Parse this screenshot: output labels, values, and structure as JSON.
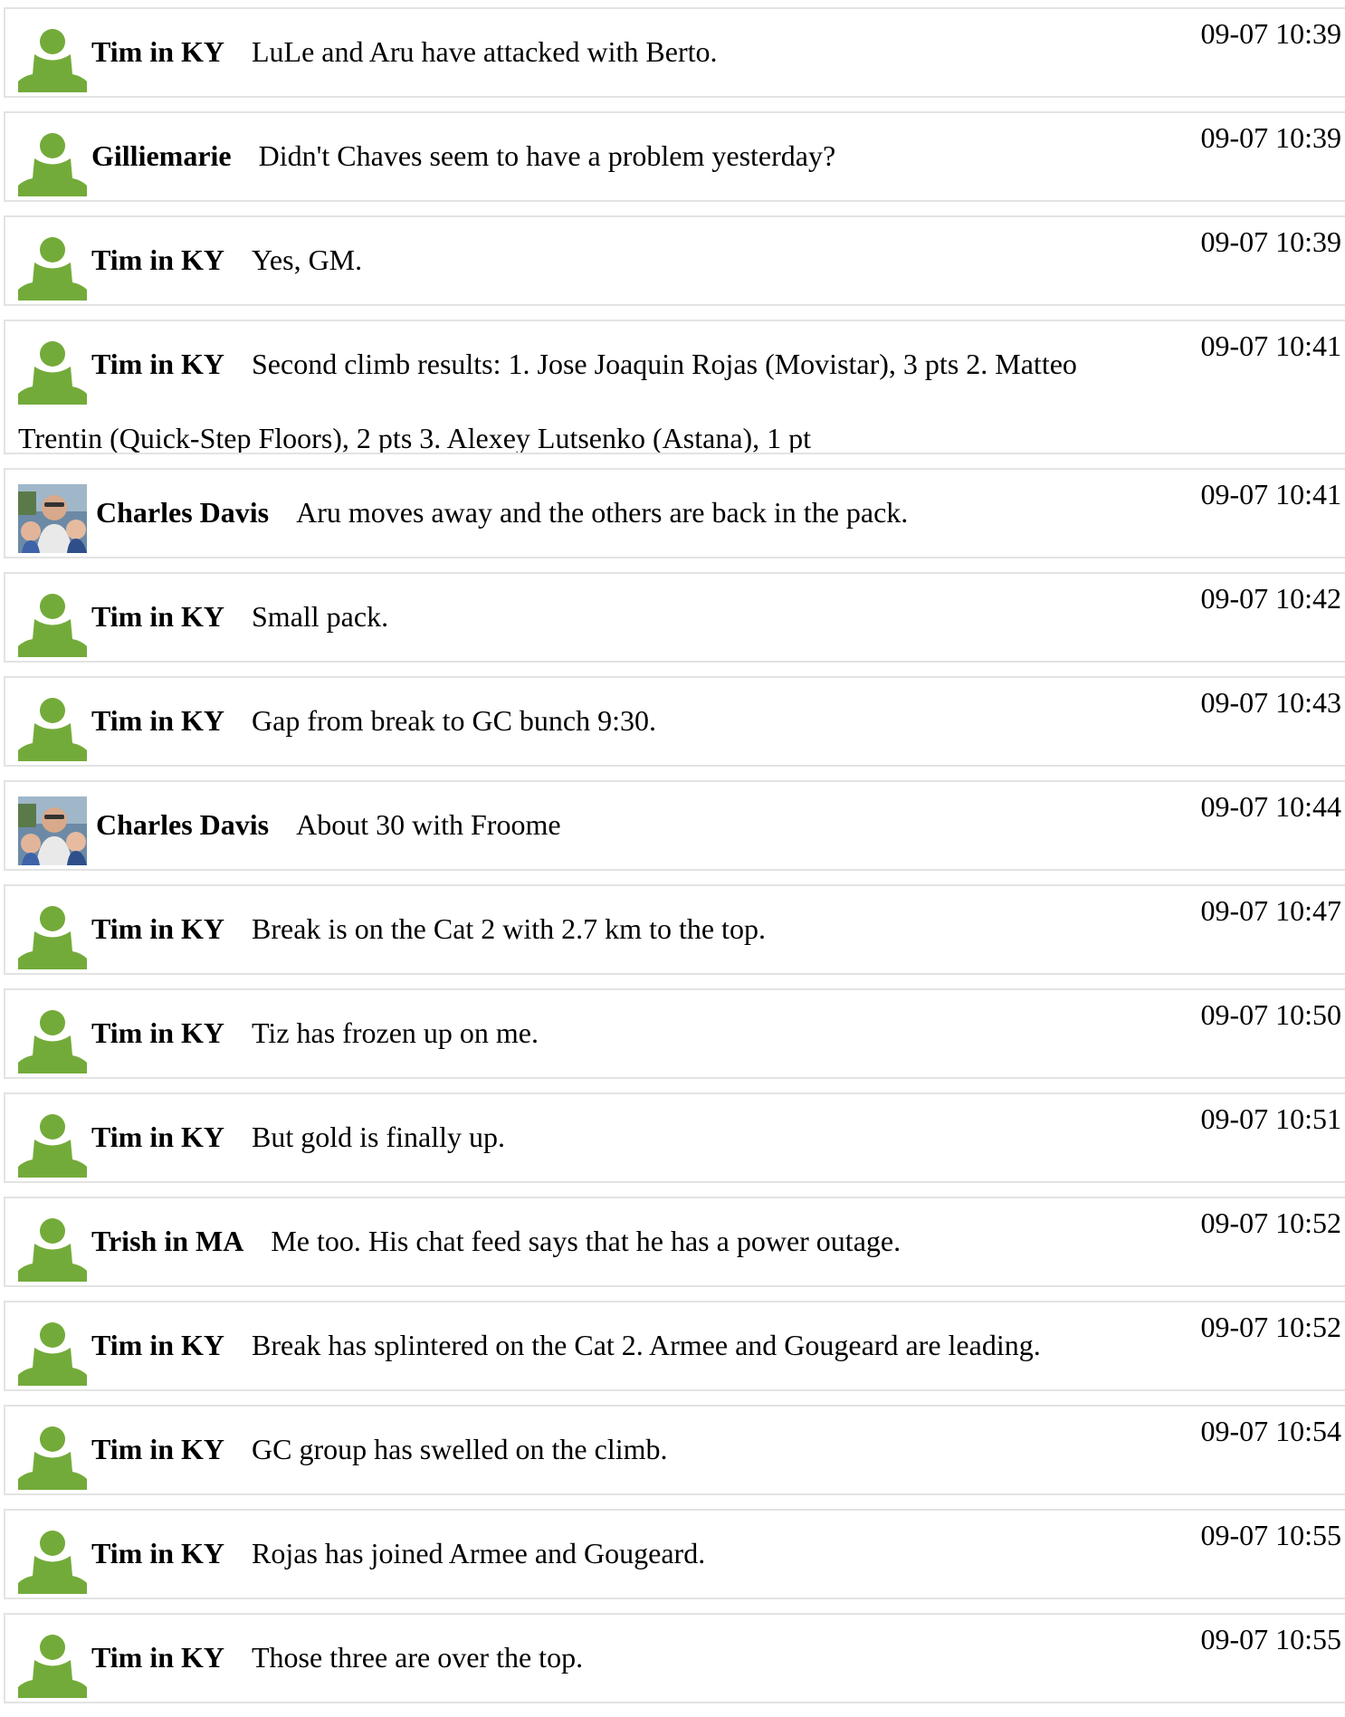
{
  "messages": [
    {
      "author": "Tim in KY",
      "avatar": "default-user-icon",
      "text": "LuLe and Aru have attacked with Berto.",
      "time": "09-07 10:39"
    },
    {
      "author": "Gilliemarie",
      "avatar": "default-user-icon",
      "text": "Didn't Chaves seem to have a problem yesterday?",
      "time": "09-07 10:39"
    },
    {
      "author": "Tim in KY",
      "avatar": "default-user-icon",
      "text": "Yes, GM.",
      "time": "09-07 10:39"
    },
    {
      "author": "Tim in KY",
      "avatar": "default-user-icon",
      "text": "Second climb results: 1. Jose Joaquin Rojas (Movistar), 3 pts 2. Matteo Trentin (Quick-Step Floors), 2 pts 3. Alexey Lutsenko (Astana), 1 pt",
      "time": "09-07 10:41"
    },
    {
      "author": "Charles Davis",
      "avatar": "profile-photo",
      "text": "Aru moves away and the others are back in the pack.",
      "time": "09-07 10:41"
    },
    {
      "author": "Tim in KY",
      "avatar": "default-user-icon",
      "text": "Small pack.",
      "time": "09-07 10:42"
    },
    {
      "author": "Tim in KY",
      "avatar": "default-user-icon",
      "text": "Gap from break to GC bunch 9:30.",
      "time": "09-07 10:43"
    },
    {
      "author": "Charles Davis",
      "avatar": "profile-photo",
      "text": "About 30 with Froome",
      "time": "09-07 10:44"
    },
    {
      "author": "Tim in KY",
      "avatar": "default-user-icon",
      "text": "Break is on the Cat 2 with 2.7 km to the top.",
      "time": "09-07 10:47"
    },
    {
      "author": "Tim in KY",
      "avatar": "default-user-icon",
      "text": "Tiz has frozen up on me.",
      "time": "09-07 10:50"
    },
    {
      "author": "Tim in KY",
      "avatar": "default-user-icon",
      "text": "But gold is finally up.",
      "time": "09-07 10:51"
    },
    {
      "author": "Trish in MA",
      "avatar": "default-user-icon",
      "text": "Me too. His chat feed says that he has a power outage.",
      "time": "09-07 10:52"
    },
    {
      "author": "Tim in KY",
      "avatar": "default-user-icon",
      "text": "Break has splintered on the Cat 2. Armee and Gougeard are leading.",
      "time": "09-07 10:52"
    },
    {
      "author": "Tim in KY",
      "avatar": "default-user-icon",
      "text": "GC group has swelled on the climb.",
      "time": "09-07 10:54"
    },
    {
      "author": "Tim in KY",
      "avatar": "default-user-icon",
      "text": "Rojas has joined Armee and Gougeard.",
      "time": "09-07 10:55"
    },
    {
      "author": "Tim in KY",
      "avatar": "default-user-icon",
      "text": "Those three are over the top.",
      "time": "09-07 10:55"
    }
  ],
  "colors": {
    "default_avatar": "#73ab3a",
    "row_border": "#e3e3e3"
  }
}
